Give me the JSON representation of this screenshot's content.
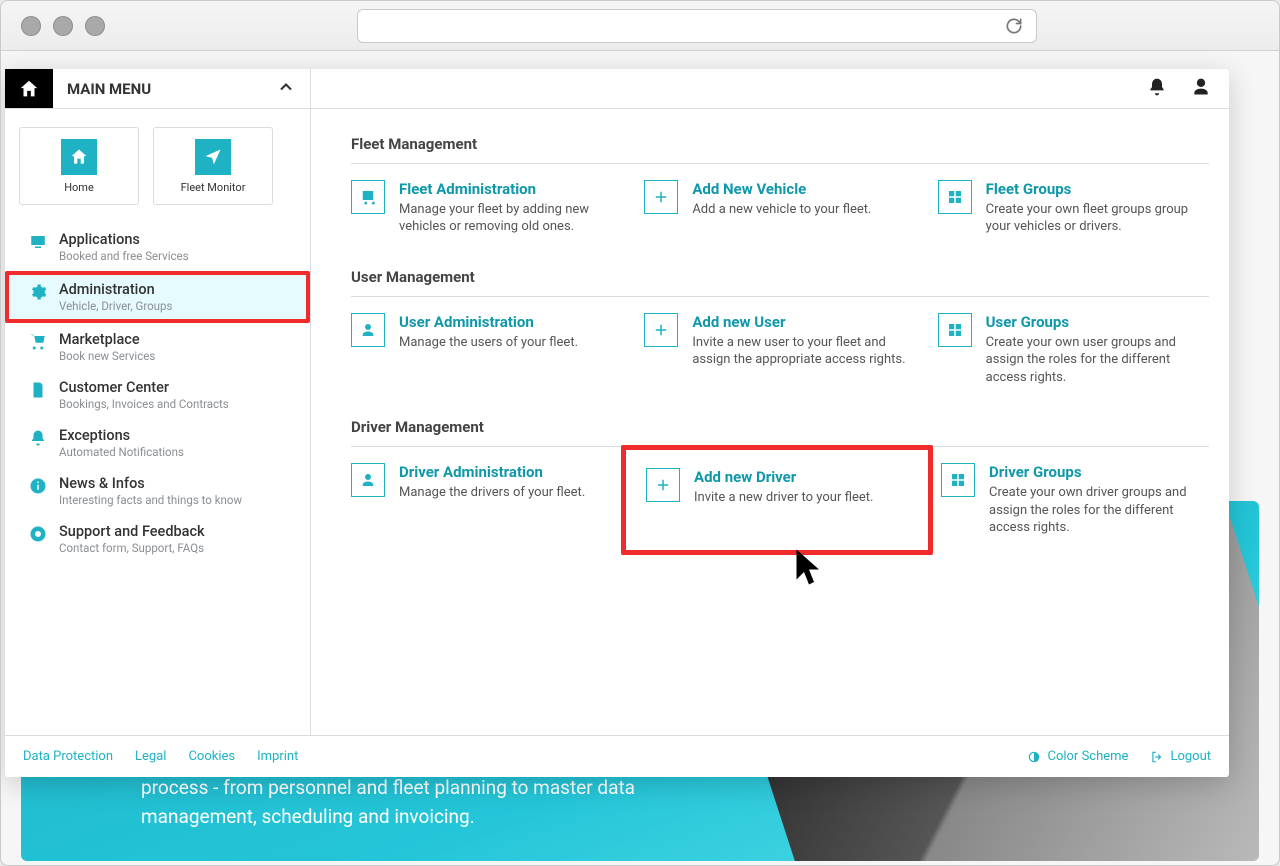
{
  "topbar": {
    "menu_title": "MAIN MENU"
  },
  "sidebar": {
    "quick_home": "Home",
    "quick_monitor": "Fleet Monitor",
    "items": [
      {
        "title": "Applications",
        "sub": "Booked and free Services"
      },
      {
        "title": "Administration",
        "sub": "Vehicle, Driver, Groups"
      },
      {
        "title": "Marketplace",
        "sub": "Book new Services"
      },
      {
        "title": "Customer Center",
        "sub": "Bookings, Invoices and Contracts"
      },
      {
        "title": "Exceptions",
        "sub": "Automated Notifications"
      },
      {
        "title": "News & Infos",
        "sub": "Interesting facts and things to know"
      },
      {
        "title": "Support and Feedback",
        "sub": "Contact form, Support, FAQs"
      }
    ]
  },
  "sections": {
    "fleet": {
      "heading": "Fleet Management",
      "cards": [
        {
          "title": "Fleet Administration",
          "desc": "Manage your fleet by adding new vehicles or removing old ones."
        },
        {
          "title": "Add New Vehicle",
          "desc": "Add a new vehicle to your fleet."
        },
        {
          "title": "Fleet Groups",
          "desc": "Create your own fleet groups group your vehicles or drivers."
        }
      ]
    },
    "user": {
      "heading": "User Management",
      "cards": [
        {
          "title": "User Administration",
          "desc": "Manage the users of your fleet."
        },
        {
          "title": "Add new User",
          "desc": "Invite a new user to your fleet and assign the appropriate access rights."
        },
        {
          "title": "User Groups",
          "desc": "Create your own user groups and assign the roles for the different access rights."
        }
      ]
    },
    "driver": {
      "heading": "Driver Management",
      "cards": [
        {
          "title": "Driver Administration",
          "desc": "Manage the drivers of your fleet."
        },
        {
          "title": "Add new Driver",
          "desc": "Invite a new driver to your fleet."
        },
        {
          "title": "Driver Groups",
          "desc": "Create your own driver groups and assign the roles for the different access rights."
        }
      ]
    }
  },
  "footer": {
    "left": [
      "Data Protection",
      "Legal",
      "Cookies",
      "Imprint"
    ],
    "color_scheme": "Color Scheme",
    "logout": "Logout"
  },
  "hero": {
    "text": "supporter. It accompanies you throughout the entire transport process - from personnel and fleet planning to master data management, scheduling and invoicing."
  }
}
